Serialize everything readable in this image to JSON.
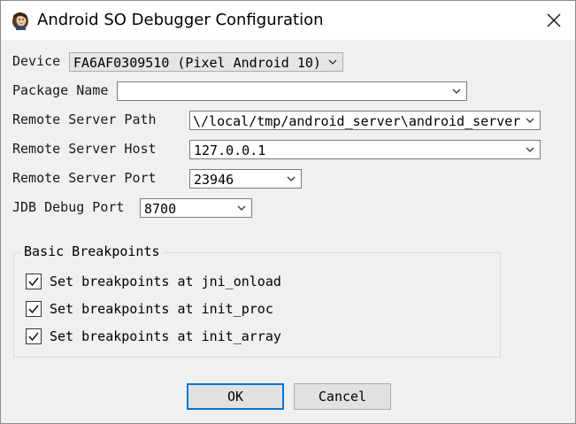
{
  "window": {
    "title": "Android SO Debugger Configuration",
    "close_glyph": "✕"
  },
  "form": {
    "device": {
      "label": "Device",
      "value": "FA6AF0309510 (Pixel Android 10)"
    },
    "package_name": {
      "label": "Package Name",
      "value": ""
    },
    "remote_server_path": {
      "label": "Remote Server Path",
      "value": "\\/local/tmp/android_server\\android_server"
    },
    "remote_server_host": {
      "label": "Remote Server Host",
      "value": "127.0.0.1"
    },
    "remote_server_port": {
      "label": "Remote Server Port",
      "value": "23946"
    },
    "jdb_debug_port": {
      "label": "JDB Debug Port",
      "value": "8700"
    }
  },
  "breakpoints": {
    "group_label": "Basic Breakpoints",
    "items": [
      {
        "label": "Set breakpoints at jni_onload",
        "checked": true
      },
      {
        "label": "Set breakpoints at init_proc",
        "checked": true
      },
      {
        "label": "Set breakpoints at init_array",
        "checked": true
      }
    ]
  },
  "buttons": {
    "ok_label": "OK",
    "cancel_label": "Cancel"
  },
  "colors": {
    "accent": "#0078d7",
    "titlebar": "#ffffff",
    "dialog_bg": "#f0f0f0"
  },
  "icons": {
    "app": "app-logo-icon",
    "close": "close-icon",
    "dropdown": "chevron-down-icon",
    "check": "checkmark-icon"
  }
}
